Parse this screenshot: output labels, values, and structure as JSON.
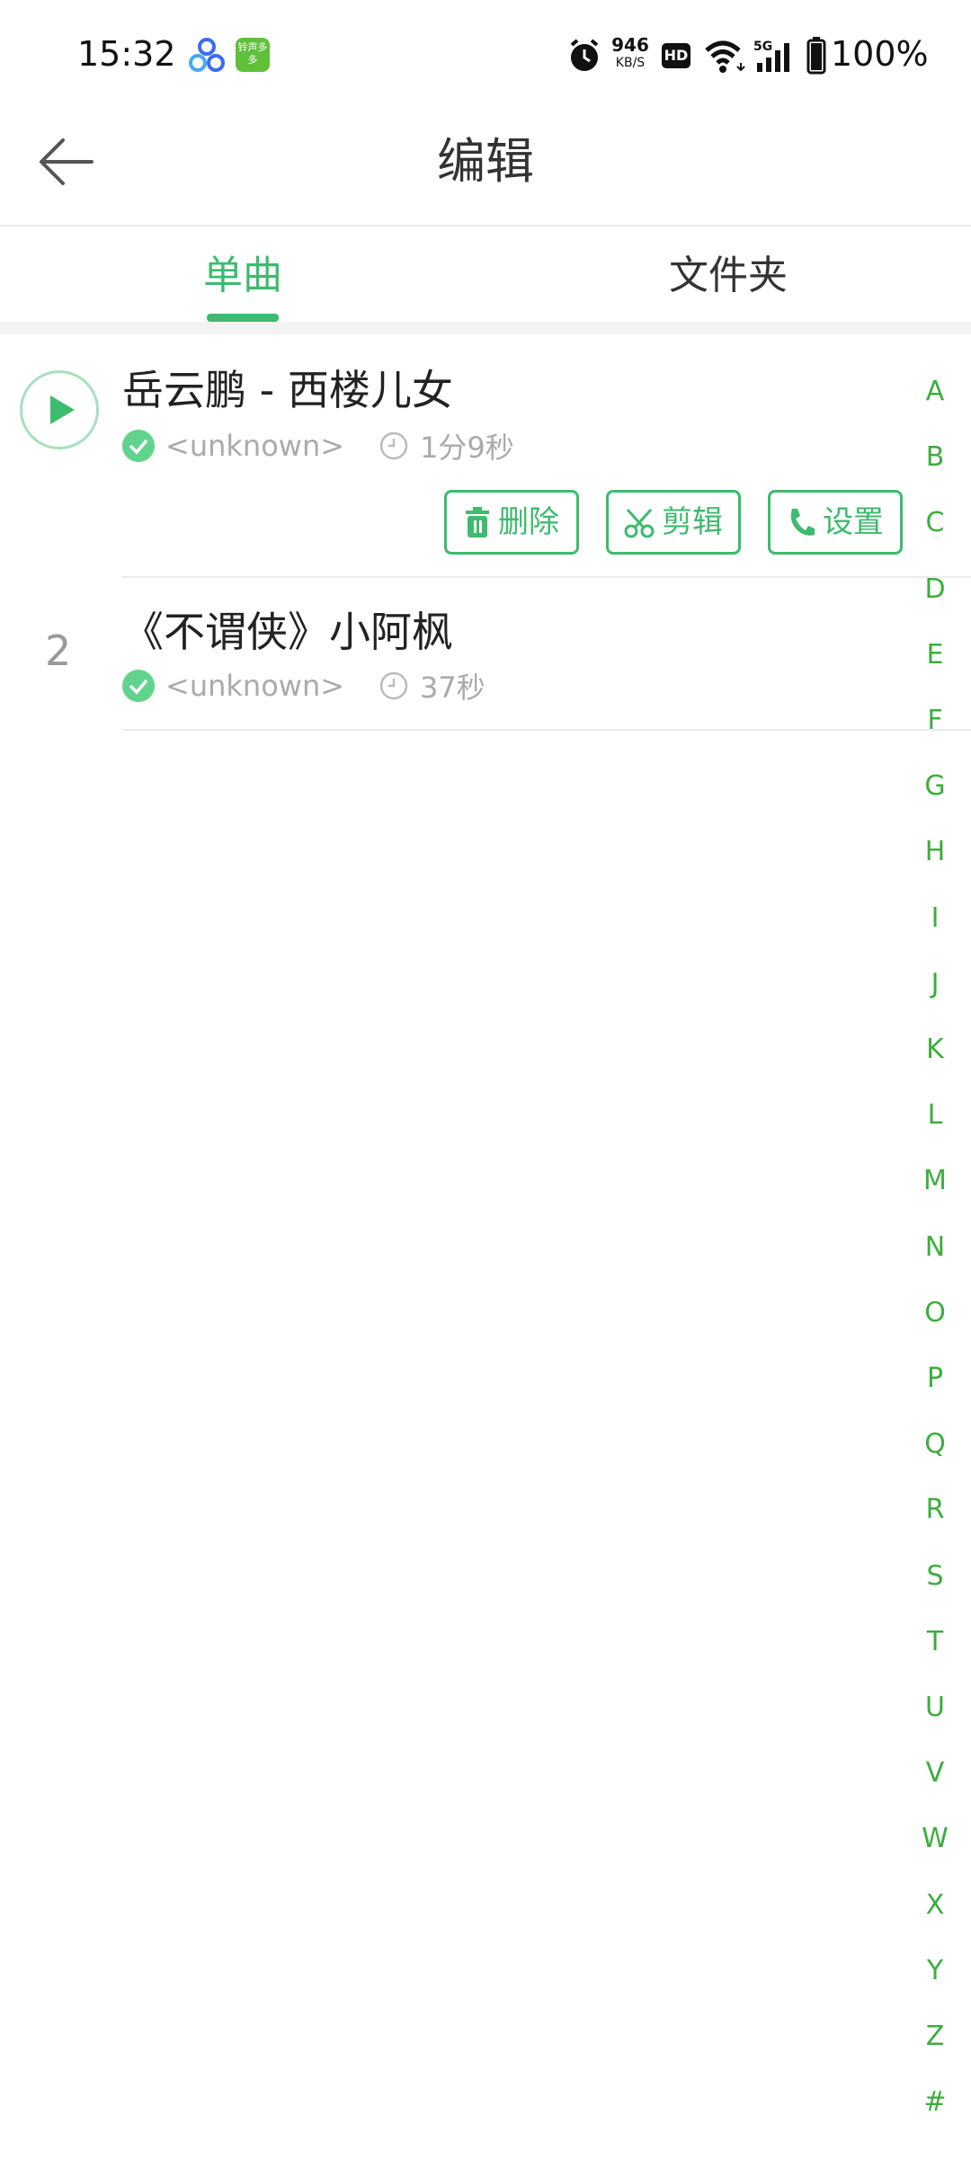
{
  "status_bar": {
    "time": "15:32",
    "app_icon_2_text": "铃声多多",
    "net_speed_value": "946",
    "net_speed_unit": "KB/S",
    "hd": "HD",
    "battery": "100%"
  },
  "header": {
    "title": "编辑"
  },
  "tabs": [
    {
      "label": "单曲",
      "active": true
    },
    {
      "label": "文件夹",
      "active": false
    }
  ],
  "songs": [
    {
      "number": "",
      "title": "岳云鹏 - 西楼儿女",
      "artist": "<unknown>",
      "duration": "1分9秒"
    },
    {
      "number": "2",
      "title": "《不谓侠》小阿枫",
      "artist": "<unknown>",
      "duration": "37秒"
    }
  ],
  "actions": {
    "delete": "删除",
    "cut": "剪辑",
    "set": "设置"
  },
  "index": [
    "A",
    "B",
    "C",
    "D",
    "E",
    "F",
    "G",
    "H",
    "I",
    "J",
    "K",
    "L",
    "M",
    "N",
    "O",
    "P",
    "Q",
    "R",
    "S",
    "T",
    "U",
    "V",
    "W",
    "X",
    "Y",
    "Z",
    "#"
  ],
  "colors": {
    "accent": "#3dbb6e",
    "index_letter": "#3cae3c"
  }
}
